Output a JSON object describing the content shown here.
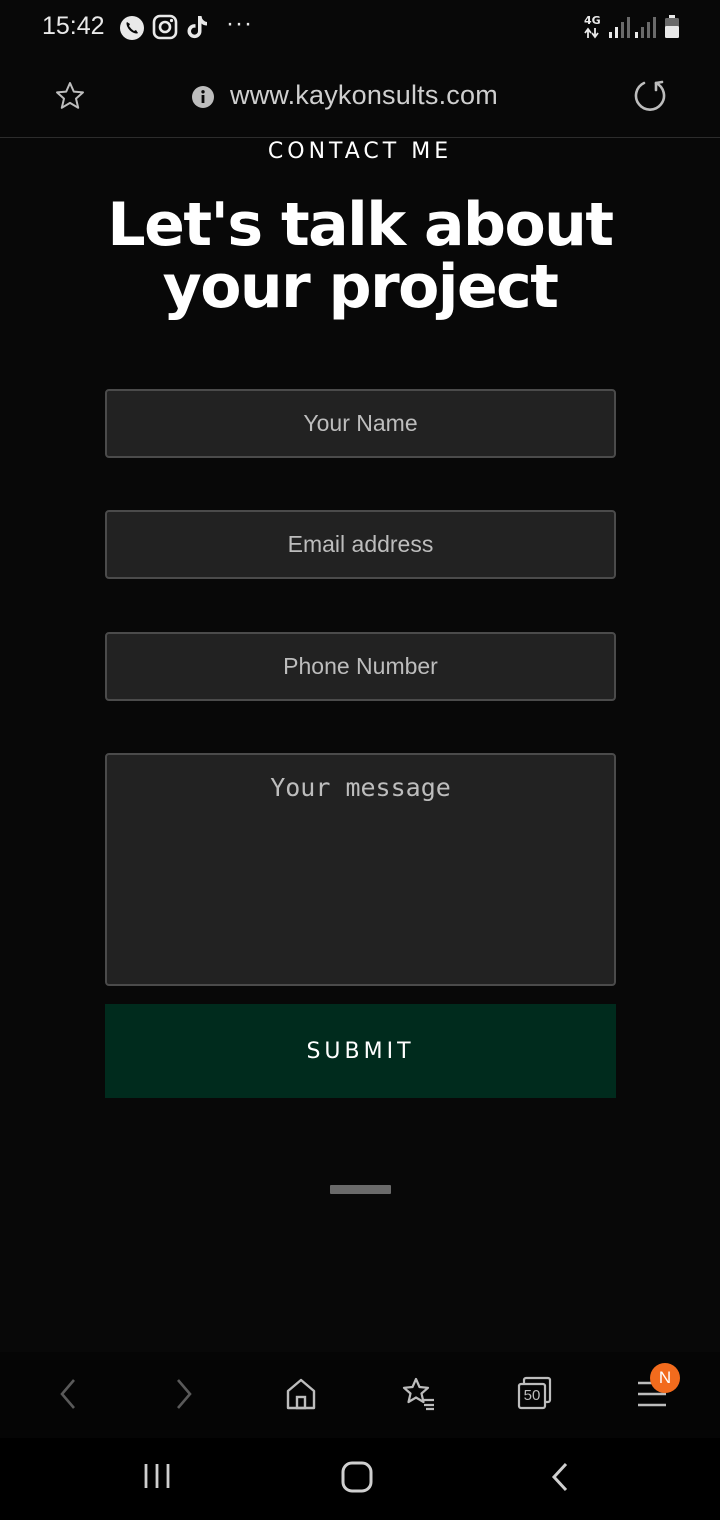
{
  "status_bar": {
    "time": "15:42",
    "icons_left": [
      "phone-icon",
      "instagram-icon",
      "tiktok-icon",
      "more-notifications-icon"
    ],
    "more_label": "···",
    "network_label": "4G",
    "icons_right": [
      "signal-icon",
      "signal-icon",
      "battery-icon"
    ]
  },
  "browser": {
    "url": "www.kaykonsults.com",
    "icons": [
      "star-icon",
      "info-icon",
      "reload-icon"
    ]
  },
  "page": {
    "kicker": "CONTACT ME",
    "headline": "Let's talk about your project",
    "form": {
      "name_placeholder": "Your Name",
      "email_placeholder": "Email address",
      "phone_placeholder": "Phone Number",
      "message_placeholder": "Your message",
      "submit_label": "SUBMIT"
    }
  },
  "toolbar": {
    "items": [
      "back-icon",
      "forward-icon",
      "home-icon",
      "bookmarks-icon",
      "tabs-icon",
      "menu-icon"
    ],
    "tabs_count": "50",
    "menu_badge": "N"
  },
  "nav_bar": {
    "items": [
      "recent-apps-icon",
      "home-button-icon",
      "back-icon"
    ]
  },
  "colors": {
    "background": "#080808",
    "field_background": "#222222",
    "submit_background": "#002b1d",
    "badge": "#f26b1d"
  }
}
